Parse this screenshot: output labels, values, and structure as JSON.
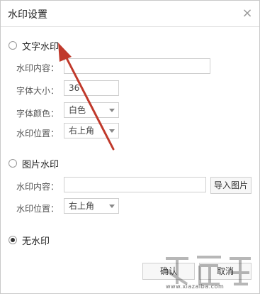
{
  "dialog": {
    "title": "水印设置",
    "close_glyph": "×"
  },
  "text_watermark": {
    "label": "文字水印",
    "selected": false,
    "content_label": "水印内容：",
    "content_value": "",
    "size_label": "字体大小：",
    "size_value": "36",
    "color_label": "字体颜色：",
    "color_value": "白色",
    "position_label": "水印位置：",
    "position_value": "右上角"
  },
  "image_watermark": {
    "label": "图片水印",
    "selected": false,
    "content_label": "水印内容：",
    "content_value": "",
    "import_button": "导入图片",
    "position_label": "水印位置：",
    "position_value": "右上角"
  },
  "no_watermark": {
    "label": "无水印",
    "selected": true
  },
  "footer": {
    "confirm_label": "确认",
    "cancel_label": "取消"
  },
  "annotation": {
    "color": "#c0392b"
  },
  "watermark_overlay": {
    "site_text": "www.xiazaiba.com"
  }
}
